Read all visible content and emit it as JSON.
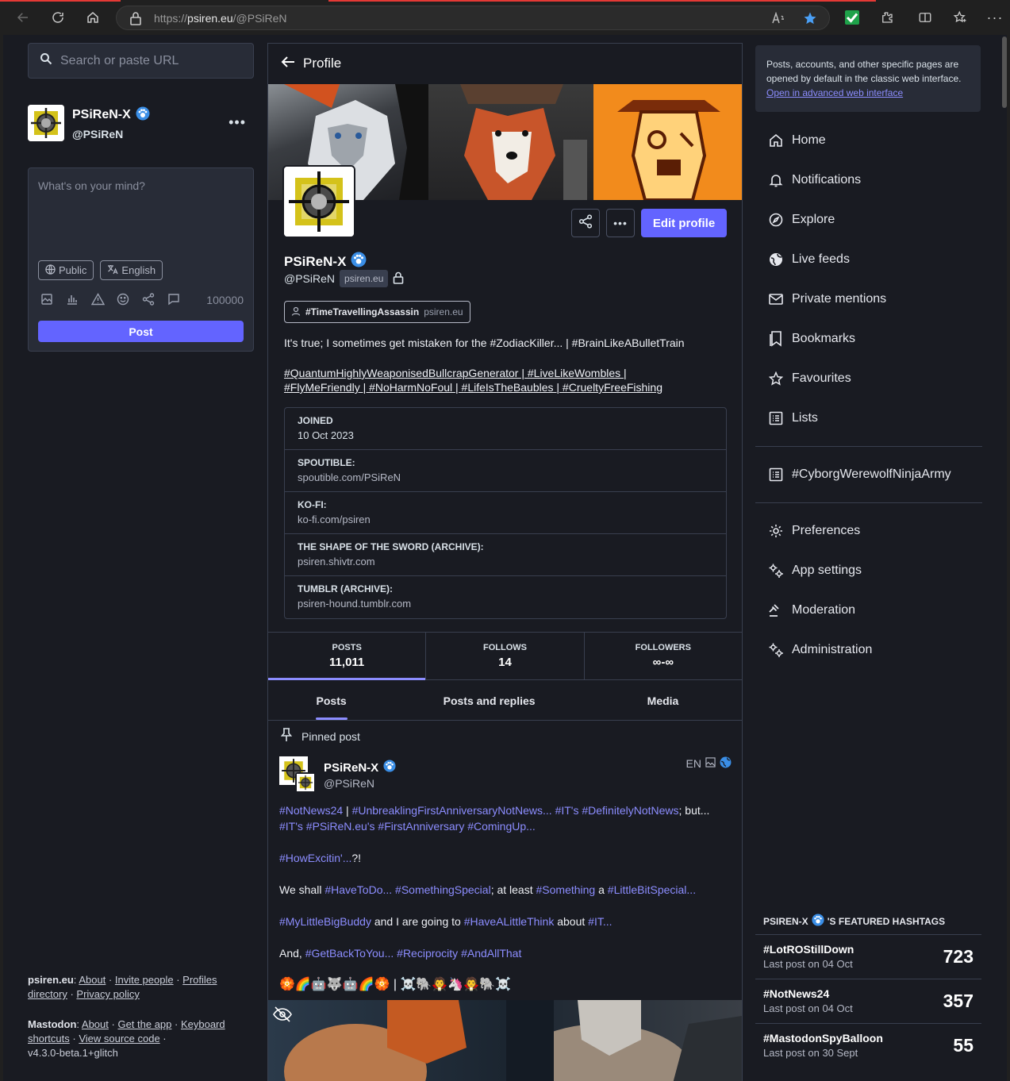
{
  "browser": {
    "url_scheme": "https://",
    "url_host": "psiren.eu",
    "url_path": "/@PSiReN"
  },
  "search": {
    "placeholder": "Search or paste URL"
  },
  "account": {
    "display_name": "PSiReN-X",
    "handle": "@PSiReN"
  },
  "compose": {
    "placeholder": "What's on your mind?",
    "visibility": "Public",
    "language": "English",
    "char_count": "100000",
    "post_label": "Post"
  },
  "footer": {
    "site": "psiren.eu",
    "site_links": [
      "About",
      "Invite people",
      "Profiles directory",
      "Privacy policy"
    ],
    "mastodon": "Mastodon",
    "mastodon_links": [
      "About",
      "Get the app",
      "Keyboard shortcuts",
      "View source code"
    ],
    "version": "v4.3.0-beta.1+glitch"
  },
  "profile": {
    "header_title": "Profile",
    "display_name": "PSiReN-X",
    "handle": "@PSiReN",
    "domain": "psiren.eu",
    "edit_label": "Edit profile",
    "featured_tag": "#TimeTravellingAssassin",
    "featured_tag_domain": "psiren.eu",
    "bio_line1": "It's true; I sometimes get mistaken for the #ZodiacKiller... | #BrainLikeABulletTrain",
    "bio_line2": "#QuantumHighlyWeaponisedBullcrapGenerator | #LiveLikeWombles |",
    "bio_line3": "#FlyMeFriendly | #NoHarmNoFoul | #LifeIsTheBaubles | #CrueltyFreeFishing",
    "fields": [
      {
        "key": "JOINED",
        "value": "10 Oct 2023"
      },
      {
        "key": "SPOUTIBLE:",
        "value": "spoutible.com/PSiReN"
      },
      {
        "key": "KO-FI:",
        "value": "ko-fi.com/psiren"
      },
      {
        "key": "THE SHAPE OF THE SWORD (ARCHIVE):",
        "value": "psiren.shivtr.com"
      },
      {
        "key": "TUMBLR (ARCHIVE):",
        "value": "psiren-hound.tumblr.com"
      }
    ],
    "counts": [
      {
        "label": "POSTS",
        "value": "11,011"
      },
      {
        "label": "FOLLOWS",
        "value": "14"
      },
      {
        "label": "FOLLOWERS",
        "value": "∞-∞"
      }
    ],
    "tabs": [
      "Posts",
      "Posts and replies",
      "Media"
    ]
  },
  "pinned_post": {
    "label": "Pinned post",
    "display_name": "PSiReN-X",
    "handle": "@PSiReN",
    "lang": "EN",
    "paragraphs": [
      "#NotNews24 | #UnbreaklingFirstAnniversaryNotNews... #IT's #DefinitelyNotNews; but... #IT's #PSiReN.eu's #FirstAnniversary #ComingUp...",
      "#HowExcitin'...?!",
      "We shall #HaveToDo... #SomethingSpecial; at least #Something a #LittleBitSpecial...",
      "#MyLittleBigBuddy and I are going to #HaveALittleThink about #IT...",
      "And, #GetBackToYou... #Reciprocity #AndAllThat"
    ],
    "emoji_line": "🏵️🌈🤖🐺🤖🌈🏵️ | ☠️🐘🧛🦄🧛🐘☠️"
  },
  "notice": {
    "text": "Posts, accounts, and other specific pages are opened by default in the classic web interface.",
    "link": "Open in advanced web interface"
  },
  "nav": {
    "items": [
      "Home",
      "Notifications",
      "Explore",
      "Live feeds",
      "Private mentions",
      "Bookmarks",
      "Favourites",
      "Lists"
    ],
    "list": "#CyborgWerewolfNinjaArmy",
    "settings": [
      "Preferences",
      "App settings",
      "Moderation",
      "Administration"
    ]
  },
  "featured_hashtags": {
    "title_prefix": "PSIREN-X",
    "title_suffix": "'S FEATURED HASHTAGS",
    "items": [
      {
        "tag": "#LotROStillDown",
        "last": "Last post on 04 Oct",
        "count": "723"
      },
      {
        "tag": "#NotNews24",
        "last": "Last post on 04 Oct",
        "count": "357"
      },
      {
        "tag": "#MastodonSpyBalloon",
        "last": "Last post on 30 Sept",
        "count": "55"
      }
    ]
  },
  "colors": {
    "accent": "#6364ff",
    "link": "#8c8dff",
    "background": "#191b22",
    "panel": "#282c37"
  }
}
